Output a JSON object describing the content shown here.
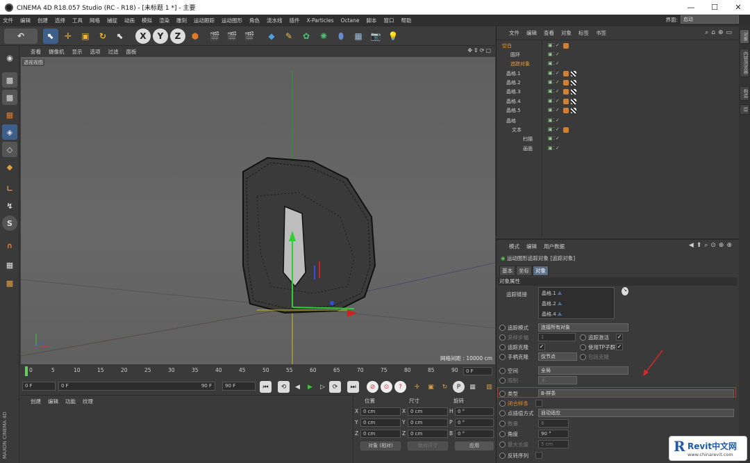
{
  "window": {
    "title": "CINEMA 4D R18.057 Studio (RC - R18) - [未标题 1 *] - 主要",
    "controls": [
      "—",
      "☐",
      "✕"
    ]
  },
  "menubar": [
    "文件",
    "编辑",
    "创建",
    "选择",
    "工具",
    "网格",
    "捕捉",
    "动画",
    "模拟",
    "渲染",
    "雕刻",
    "运动跟踪",
    "运动图形",
    "角色",
    "流水线",
    "插件",
    "X-Particles",
    "Octane",
    "脚本",
    "窗口",
    "帮助"
  ],
  "interface": {
    "label": "界面:",
    "value": "启动"
  },
  "viewport": {
    "menu": [
      "查看",
      "摄像机",
      "显示",
      "选项",
      "过滤",
      "面板"
    ],
    "label": "透视视图",
    "grid_spacing": "网格间距 : 10000 cm"
  },
  "timeline": {
    "ticks": [
      "0",
      "5",
      "10",
      "15",
      "20",
      "25",
      "30",
      "35",
      "40",
      "45",
      "50",
      "55",
      "60",
      "65",
      "70",
      "75",
      "80",
      "85",
      "90"
    ],
    "end_frame": "0 F"
  },
  "transport": {
    "start": "0 F",
    "range_start": "0 F",
    "range_end": "90 F",
    "end": "90 F"
  },
  "material_panel": {
    "menu": [
      "创建",
      "编辑",
      "功能",
      "纹理"
    ],
    "brand": "MAXON CINEMA 4D"
  },
  "coords": {
    "headers": [
      "位置",
      "尺寸",
      "旋转"
    ],
    "rows": [
      {
        "axis": "X",
        "pos": "0 cm",
        "size_axis": "X",
        "size": "0 cm",
        "rot_axis": "H",
        "rot": "0 °"
      },
      {
        "axis": "Y",
        "pos": "0 cm",
        "size_axis": "Y",
        "size": "0 cm",
        "rot_axis": "P",
        "rot": "0 °"
      },
      {
        "axis": "Z",
        "pos": "0 cm",
        "size_axis": "Z",
        "size": "0 cm",
        "rot_axis": "B",
        "rot": "0 °"
      }
    ],
    "mode": "对象 (相对)",
    "size_mode": "绝对尺寸",
    "apply": "应用"
  },
  "object_manager": {
    "menu": [
      "文件",
      "编辑",
      "查看",
      "对象",
      "标签",
      "书签"
    ],
    "objects": [
      {
        "name": "空白",
        "indent": 0
      },
      {
        "name": "圆环",
        "indent": 1
      },
      {
        "name": "追踪对象",
        "indent": 1
      },
      {
        "name": "晶格.1",
        "indent": 0
      },
      {
        "name": "晶格.2",
        "indent": 0
      },
      {
        "name": "晶格.3",
        "indent": 0
      },
      {
        "name": "晶格.4",
        "indent": 0
      },
      {
        "name": "晶格.5",
        "indent": 0
      },
      {
        "name": "晶格",
        "indent": 0
      },
      {
        "name": "文本",
        "indent": 1
      },
      {
        "name": "扫描",
        "indent": 2
      },
      {
        "name": "画面",
        "indent": 2
      }
    ]
  },
  "attributes": {
    "menu": [
      "模式",
      "编辑",
      "用户数据"
    ],
    "title": "运动图形追踪对象 [追踪对象]",
    "tabs": [
      "基本",
      "坐标",
      "对象"
    ],
    "section": "对象属性",
    "track_link_label": "追踪链接",
    "track_items": [
      "晶格.1",
      "晶格.2",
      "晶格.4"
    ],
    "track_mode_label": "追踪模式",
    "track_mode": "连接所有对象",
    "sampling_label": "采样步幅",
    "sampling": "1",
    "track_active_label": "追踪激活",
    "track_clones_label": "追踪克隆",
    "use_tp_label": "使用TP子群",
    "handle_clone_label": "手柄克隆",
    "handle_clone": "仅节点",
    "include_clone_label": "包括克隆",
    "space_label": "空间",
    "space": "全局",
    "limit_label": "限制",
    "limit": "无",
    "type_label": "类型",
    "type": "B-样条",
    "closed_label": "闭合样条",
    "interp_label": "点插值方式",
    "interp": "自动适应",
    "count_label": "数量",
    "count": "8",
    "angle_label": "角度",
    "angle": "90 °",
    "max_len_label": "最大长度",
    "max_len": "5 cm",
    "reverse_label": "反转序列"
  },
  "right_tabs": [
    "对象",
    "内容浏览器",
    "构造",
    "层"
  ],
  "watermark": {
    "logo": "R",
    "text": "Revit中文网",
    "url": "www.chinarevit.com"
  }
}
